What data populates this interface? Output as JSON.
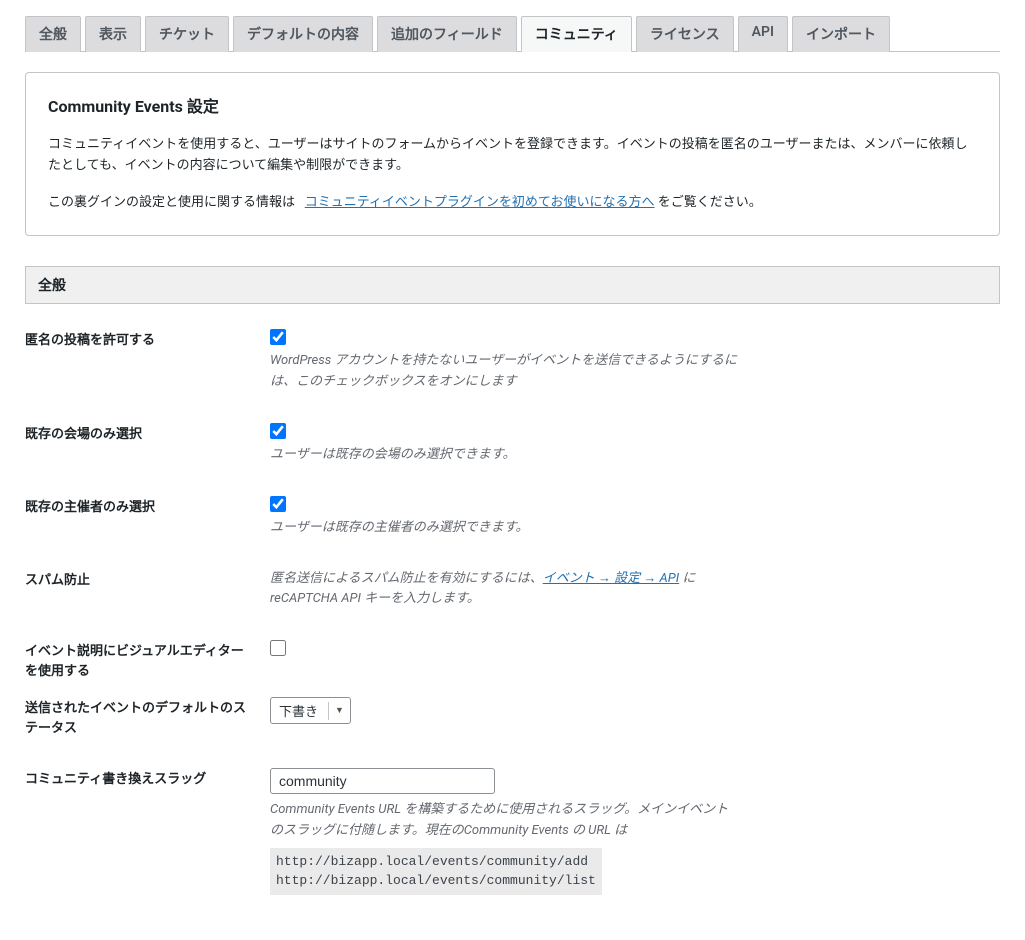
{
  "tabs": {
    "general": "全般",
    "display": "表示",
    "tickets": "チケット",
    "defaults": "デフォルトの内容",
    "additional": "追加のフィールド",
    "community": "コミュニティ",
    "license": "ライセンス",
    "api": "API",
    "import": "インポート"
  },
  "intro": {
    "heading": "Community Events 設定",
    "p1": "コミュニティイベントを使用すると、ユーザーはサイトのフォームからイベントを登録できます。イベントの投稿を匿名のユーザーまたは、メンバーに依頼したとしても、イベントの内容について編集や制限ができます。",
    "p2_before": "この裏グインの設定と使用に関する情報は",
    "p2_link": "コミュニティイベントプラグインを初めてお使いになる方へ",
    "p2_after": " をご覧ください。"
  },
  "section_general": "全般",
  "rows": {
    "anon": {
      "label": "匿名の投稿を許可する",
      "checked": true,
      "desc": "WordPress アカウントを持たないユーザーがイベントを送信できるようにするには、このチェックボックスをオンにします"
    },
    "venues": {
      "label": "既存の会場のみ選択",
      "checked": true,
      "desc": "ユーザーは既存の会場のみ選択できます。"
    },
    "organizers": {
      "label": "既存の主催者のみ選択",
      "checked": true,
      "desc": "ユーザーは既存の主催者のみ選択できます。"
    },
    "spam": {
      "label": "スパム防止",
      "desc_before": "匿名送信によるスパム防止を有効にするには、",
      "desc_link": "イベント → 設定 → API",
      "desc_after": " にreCAPTCHA API キーを入力します。"
    },
    "visual": {
      "label": "イベント説明にビジュアルエディターを使用する",
      "checked": false
    },
    "status": {
      "label": "送信されたイベントのデフォルトのステータス",
      "value": "下書き"
    },
    "slug": {
      "label": "コミュニティ書き換えスラッグ",
      "value": "community",
      "desc": "Community Events URL を構築するために使用されるスラッグ。メインイベントのスラッグに付随します。現在のCommunity Events の URL は",
      "url1": "http://bizapp.local/events/community/add",
      "url2": "http://bizapp.local/events/community/list"
    }
  }
}
